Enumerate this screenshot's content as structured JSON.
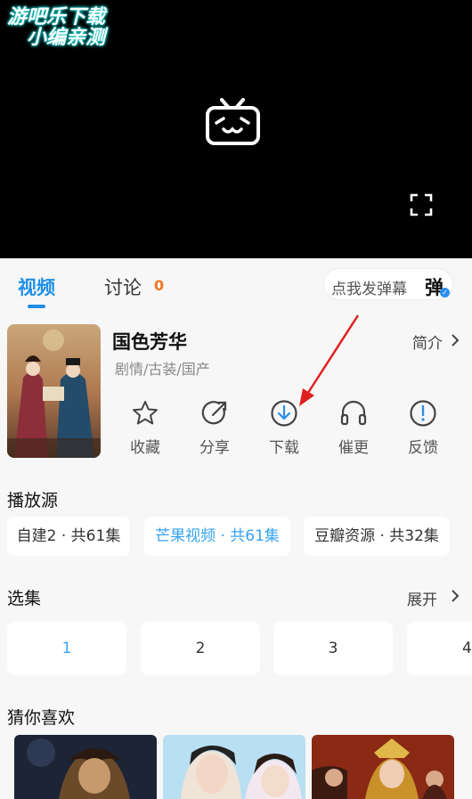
{
  "player": {
    "watermark_line1": "游吧乐下载",
    "watermark_line2": "小编亲测",
    "logo_icon": "tv-icon",
    "fullscreen_icon": "fullscreen-icon"
  },
  "tabs": {
    "video": "视频",
    "discuss": "讨论",
    "discuss_count": "0"
  },
  "danmaku": {
    "placeholder": "点我发弹幕",
    "button_label": "弹"
  },
  "show": {
    "title": "国色芳华",
    "genre": "剧情/古装/国产",
    "intro_label": "简介"
  },
  "actions": [
    {
      "label": "收藏",
      "icon": "star-icon"
    },
    {
      "label": "分享",
      "icon": "share-icon"
    },
    {
      "label": "下载",
      "icon": "download-icon"
    },
    {
      "label": "催更",
      "icon": "headphones-icon"
    },
    {
      "label": "反馈",
      "icon": "feedback-icon"
    }
  ],
  "sources": {
    "title": "播放源",
    "items": [
      "自建2 · 共61集",
      "芒果视频 · 共61集",
      "豆瓣资源 · 共32集"
    ],
    "active": "芒果视频 · 共61集"
  },
  "episodes": {
    "title": "选集",
    "expand_label": "展开",
    "items": [
      "1",
      "2",
      "3",
      "4"
    ],
    "active": "1"
  },
  "recommend": {
    "title": "猜你喜欢"
  },
  "colors": {
    "accent": "#1f8fe8",
    "count": "#f5761f",
    "arrow": "#e02020"
  }
}
